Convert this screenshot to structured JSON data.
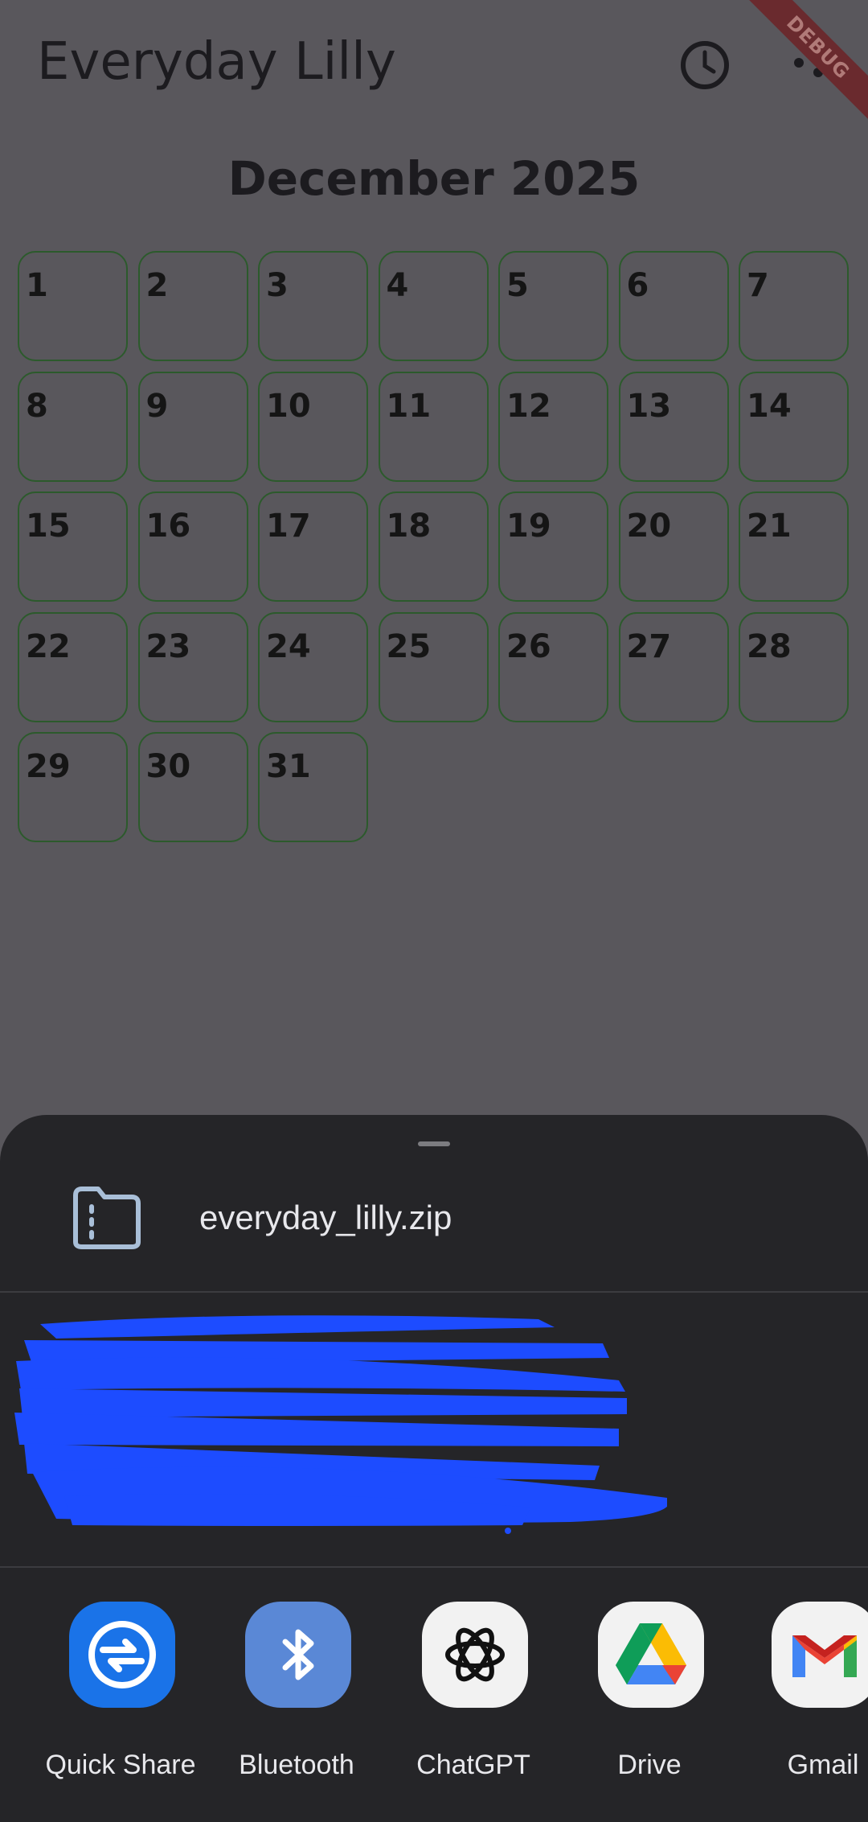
{
  "app": {
    "title": "Everyday Lilly",
    "debug_label": "DEBUG",
    "month_title": "December 2025",
    "days": [
      "1",
      "2",
      "3",
      "4",
      "5",
      "6",
      "7",
      "8",
      "9",
      "10",
      "11",
      "12",
      "13",
      "14",
      "15",
      "16",
      "17",
      "18",
      "19",
      "20",
      "21",
      "22",
      "23",
      "24",
      "25",
      "26",
      "27",
      "28",
      "29",
      "30",
      "31"
    ]
  },
  "share_sheet": {
    "file_name": "everyday_lilly.zip",
    "targets": [
      {
        "label": "Quick Share",
        "icon": "quick-share-icon",
        "color": "#1a73e8"
      },
      {
        "label": "Bluetooth",
        "icon": "bluetooth-icon",
        "color": "#5a88d6"
      },
      {
        "label": "ChatGPT",
        "icon": "chatgpt-icon",
        "color": "#f2f2f2"
      },
      {
        "label": "Drive",
        "icon": "drive-icon",
        "color": "#f2f2f2"
      },
      {
        "label": "Gmail",
        "icon": "gmail-icon",
        "color": "#f2f2f2"
      }
    ]
  },
  "colors": {
    "scrim": "#59575c",
    "sheet": "#252528",
    "day_border": "#2c5a2c",
    "redaction": "#1d4cff"
  }
}
